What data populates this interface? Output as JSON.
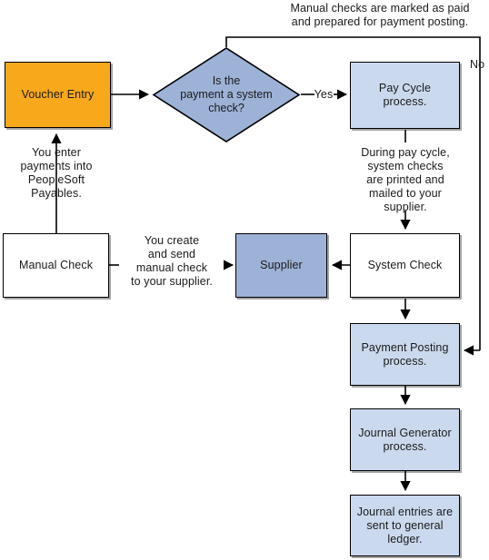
{
  "diagram": {
    "title": "PeopleSoft Payables payment process flow",
    "colors": {
      "orange": "#F7A81B",
      "light_blue": "#CBD9EE",
      "blue": "#9DB2D7",
      "white": "#FFFFFF",
      "stroke": "#000000"
    },
    "nodes": [
      {
        "id": "voucher_entry",
        "label": "Voucher Entry",
        "shape": "rect",
        "fill": "#F7A81B"
      },
      {
        "id": "decision",
        "label": "Is the\npayment a system\ncheck?",
        "shape": "diamond",
        "fill": "#9DB2D7"
      },
      {
        "id": "pay_cycle",
        "label": "Pay Cycle\nprocess.",
        "shape": "rect",
        "fill": "#CBD9EE"
      },
      {
        "id": "manual_check",
        "label": "Manual Check",
        "shape": "rect",
        "fill": "#FFFFFF"
      },
      {
        "id": "supplier",
        "label": "Supplier",
        "shape": "rect",
        "fill": "#9DB2D7"
      },
      {
        "id": "system_check",
        "label": "System Check",
        "shape": "rect",
        "fill": "#FFFFFF"
      },
      {
        "id": "payment_posting",
        "label": "Payment Posting\nprocess.",
        "shape": "rect",
        "fill": "#CBD9EE"
      },
      {
        "id": "journal_generator",
        "label": "Journal Generator\nprocess.",
        "shape": "rect",
        "fill": "#CBD9EE"
      },
      {
        "id": "journal_entries",
        "label": "Journal entries are\nsent to general\nledger.",
        "shape": "rect",
        "fill": "#CBD9EE"
      }
    ],
    "edge_labels": [
      {
        "id": "manual_checks_note",
        "text": "Manual checks are marked as paid\nand prepared for payment posting."
      },
      {
        "id": "no_branch",
        "text": "No"
      },
      {
        "id": "yes_branch",
        "text": "Yes"
      },
      {
        "id": "voucher_entry_note",
        "text": "You enter\npayments into\nPeopleSoft\nPayables."
      },
      {
        "id": "pay_cycle_note",
        "text": "During pay cycle,\nsystem checks\nare printed and\nmailed to your\nsupplier."
      },
      {
        "id": "manual_check_note",
        "text": "You create\nand send\nmanual check\nto your supplier."
      }
    ]
  }
}
